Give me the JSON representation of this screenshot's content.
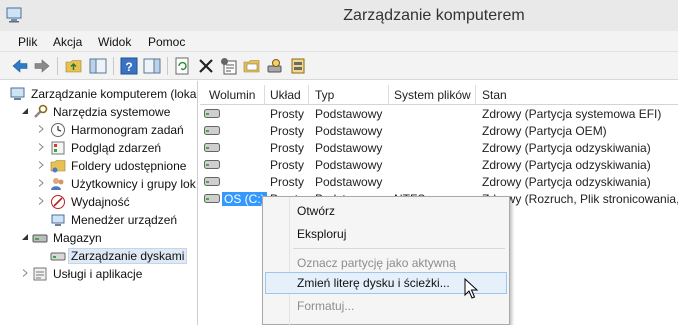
{
  "window": {
    "title": "Zarządzanie komputerem"
  },
  "menubar": {
    "items": [
      "Plik",
      "Akcja",
      "Widok",
      "Pomoc"
    ]
  },
  "toolbar": {
    "buttons": [
      "back-icon",
      "forward-icon",
      "up-folder-icon",
      "show-tree-icon",
      "help-icon",
      "action-pane-icon",
      "refresh-icon",
      "delete-icon",
      "properties-icon",
      "open-folder-icon",
      "search-disk-icon"
    ]
  },
  "tree": {
    "items": [
      {
        "label": "Zarządzanie komputerem (loka",
        "icon": "computer-management-icon"
      },
      {
        "label": "Narzędzia systemowe",
        "icon": "tools-icon"
      },
      {
        "label": "Harmonogram zadań",
        "icon": "clock-icon"
      },
      {
        "label": "Podgląd zdarzeń",
        "icon": "event-viewer-icon"
      },
      {
        "label": "Foldery udostępnione",
        "icon": "shared-folder-icon"
      },
      {
        "label": "Użytkownicy i grupy lok",
        "icon": "users-icon"
      },
      {
        "label": "Wydajność",
        "icon": "performance-icon"
      },
      {
        "label": "Menedżer urządzeń",
        "icon": "device-manager-icon"
      },
      {
        "label": "Magazyn",
        "icon": "storage-icon"
      },
      {
        "label": "Zarządzanie dyskami",
        "icon": "disk-management-icon"
      },
      {
        "label": "Usługi i aplikacje",
        "icon": "services-icon"
      }
    ]
  },
  "table": {
    "columns": [
      "Wolumin",
      "Układ",
      "Typ",
      "System plików",
      "Stan"
    ],
    "rows": [
      {
        "volume": "",
        "layout": "Prosty",
        "type": "Podstawowy",
        "fs": "",
        "status": "Zdrowy (Partycja systemowa EFI)"
      },
      {
        "volume": "",
        "layout": "Prosty",
        "type": "Podstawowy",
        "fs": "",
        "status": "Zdrowy (Partycja OEM)"
      },
      {
        "volume": "",
        "layout": "Prosty",
        "type": "Podstawowy",
        "fs": "",
        "status": "Zdrowy (Partycja odzyskiwania)"
      },
      {
        "volume": "",
        "layout": "Prosty",
        "type": "Podstawowy",
        "fs": "",
        "status": "Zdrowy (Partycja odzyskiwania)"
      },
      {
        "volume": "",
        "layout": "Prosty",
        "type": "Podstawowy",
        "fs": "",
        "status": "Zdrowy (Partycja odzyskiwania)"
      },
      {
        "volume": "OS (C:)",
        "layout": "Prosty",
        "type": "Podstawowy",
        "fs": "NTFS",
        "status": "Zdrowy (Rozruch, Plik stronicowania, Z"
      }
    ]
  },
  "context_menu": {
    "items": [
      {
        "label": "Otwórz",
        "disabled": false
      },
      {
        "label": "Eksploruj",
        "disabled": false
      },
      {
        "label": "Oznacz partycję jako aktywną",
        "disabled": true
      },
      {
        "label": "Zmień literę dysku i ścieżki...",
        "disabled": false,
        "highlighted": true
      },
      {
        "label": "Formatuj...",
        "disabled": true
      }
    ]
  },
  "colors": {
    "selection": "#3399ff",
    "menu_highlight": "#e5f0fb",
    "titlebar": "#e9e9e9"
  }
}
